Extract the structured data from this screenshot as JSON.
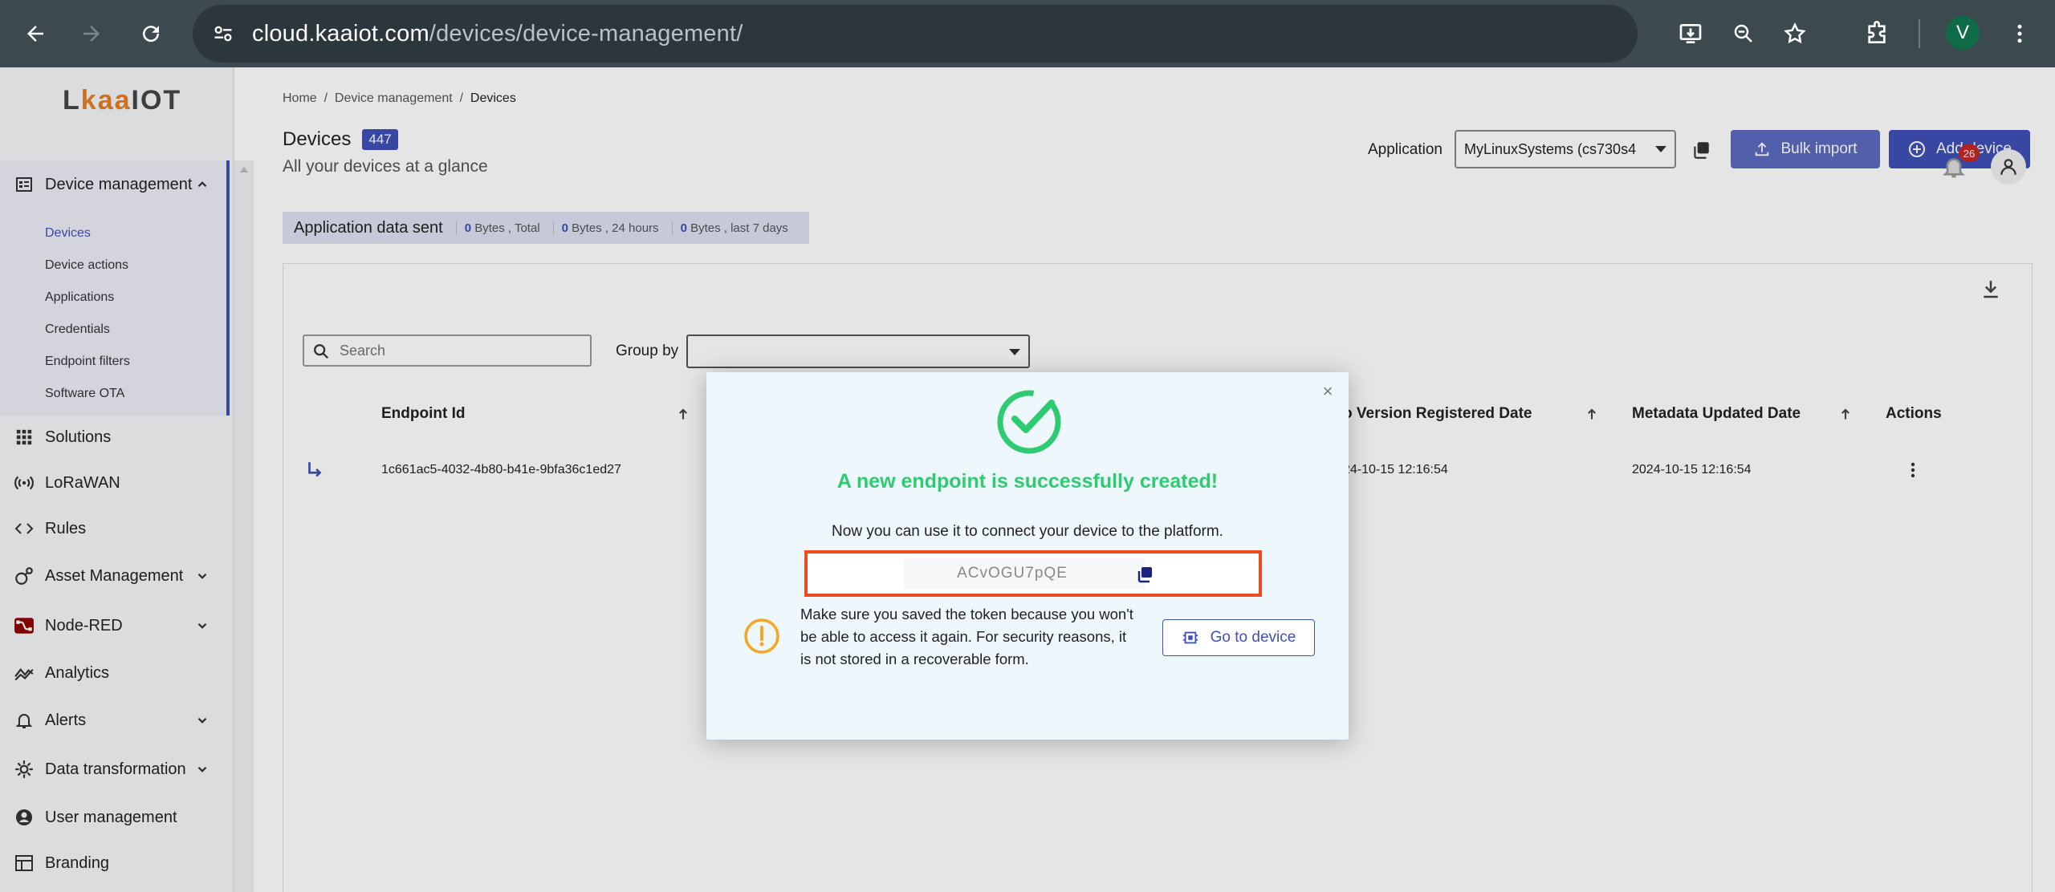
{
  "browser": {
    "url_host": "cloud.kaaiot.com",
    "url_path": "/devices/device-management/",
    "avatar_letter": "V"
  },
  "sidebar": {
    "logo_prefix": "L",
    "logo_brand": "kaa",
    "logo_suffix": "IOT",
    "device_management": "Device management",
    "sub_items": [
      "Devices",
      "Device actions",
      "Applications",
      "Credentials",
      "Endpoint filters",
      "Software OTA"
    ],
    "items": [
      {
        "label": "Solutions",
        "icon": "grid-icon",
        "chevron": false
      },
      {
        "label": "LoRaWAN",
        "icon": "wireless-icon",
        "chevron": false
      },
      {
        "label": "Rules",
        "icon": "code-icon",
        "chevron": false
      },
      {
        "label": "Asset Management",
        "icon": "asset-icon",
        "chevron": true
      },
      {
        "label": "Node-RED",
        "icon": "node-red-icon",
        "chevron": true
      },
      {
        "label": "Analytics",
        "icon": "analytics-icon",
        "chevron": false
      },
      {
        "label": "Alerts",
        "icon": "bell-icon",
        "chevron": true
      },
      {
        "label": "Data transformation",
        "icon": "transform-icon",
        "chevron": true
      },
      {
        "label": "User management",
        "icon": "user-icon",
        "chevron": false
      },
      {
        "label": "Branding",
        "icon": "branding-icon",
        "chevron": false
      }
    ]
  },
  "header": {
    "breadcrumb": [
      "Home",
      "Device management",
      "Devices"
    ],
    "title": "Devices",
    "count": "447",
    "subtitle": "All your devices at a glance",
    "application_label": "Application",
    "application_value": "MyLinuxSystems (cs730s4",
    "bulk_import": "Bulk import",
    "add_device": "Add device",
    "notification_count": "26"
  },
  "data_sent": {
    "label": "Application data sent",
    "total_num": "0",
    "total_text": "Bytes , Total",
    "day_num": "0",
    "day_text": "Bytes , 24 hours",
    "week_num": "0",
    "week_text": "Bytes , last 7 days"
  },
  "table": {
    "search_placeholder": "Search",
    "group_by_label": "Group by",
    "columns": [
      "Endpoint Id",
      "o Version Registered Date",
      "Metadata Updated Date",
      "Actions"
    ],
    "row": {
      "endpoint_id": "1c661ac5-4032-4b80-b41e-9bfa36c1ed27",
      "registered": "24-10-15 12:16:54",
      "updated": "2024-10-15 12:16:54"
    }
  },
  "modal": {
    "title": "A new endpoint is successfully created!",
    "description": "Now you can use it to connect your device to the platform.",
    "token": "ACvOGU7pQE",
    "warning": "Make sure you saved the token because you won't be able to access it again. For security reasons, it is not stored in a recoverable form.",
    "go_to_device": "Go to device",
    "close": "×"
  },
  "colors": {
    "accent": "#3f51b5",
    "success": "#2ecc71",
    "highlight": "#ee4b1f",
    "warning": "#f5a623"
  }
}
